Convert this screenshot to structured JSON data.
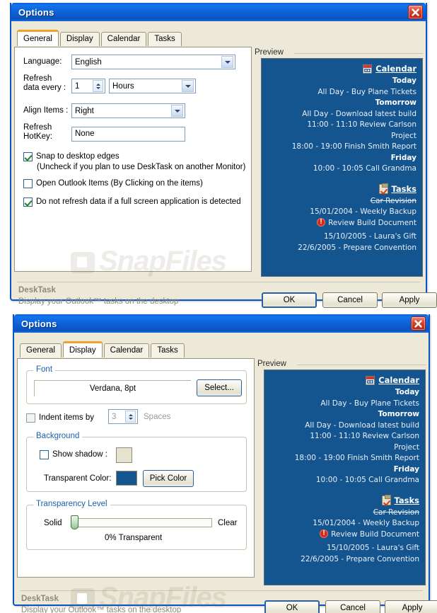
{
  "app": {
    "name": "DeskTask",
    "description": "Display your Outlook™ tasks on the desktop",
    "watermark": "SnapFiles"
  },
  "colors": {
    "titlebar_blue": "#0c60d6",
    "preview_background": "#14548f",
    "transparent_color_swatch": "#14548f",
    "shadow_swatch": "#e5e3cf",
    "active_tab_accent": "#f0a32a",
    "group_title": "#1b5fa8"
  },
  "dialog1": {
    "title": "Options",
    "close_icon": "close-icon",
    "tabs": [
      {
        "label": "General",
        "active": true
      },
      {
        "label": "Display",
        "active": false
      },
      {
        "label": "Calendar",
        "active": false
      },
      {
        "label": "Tasks",
        "active": false
      }
    ],
    "general": {
      "language_label": "Language:",
      "language_value": "English",
      "refresh_label": "Refresh\ndata every :",
      "refresh_number": "1",
      "refresh_unit": "Hours",
      "align_label": "Align Items :",
      "align_value": "Right",
      "hotkey_label": "Refresh\nHotKey:",
      "hotkey_value": "None",
      "checkbox_snap": "Snap to desktop edges",
      "checkbox_snap_note": "(Uncheck if you plan to use DeskTask on another Monitor)",
      "checkbox_open_outlook": "Open Outlook Items (By Clicking on the items)",
      "checkbox_no_refresh": "Do not refresh data if a full screen application is detected"
    },
    "preview_label": "Preview",
    "buttons": {
      "ok": "OK",
      "cancel": "Cancel",
      "apply": "Apply"
    }
  },
  "dialog2": {
    "title": "Options",
    "close_icon": "close-icon",
    "tabs": [
      {
        "label": "General",
        "active": false
      },
      {
        "label": "Display",
        "active": true
      },
      {
        "label": "Calendar",
        "active": false
      },
      {
        "label": "Tasks",
        "active": false
      }
    ],
    "display": {
      "font_group": "Font",
      "font_value": "Verdana, 8pt",
      "font_select_button": "Select...",
      "indent_label": "Indent items by",
      "indent_value": "3",
      "indent_unit": "Spaces",
      "background_group": "Background",
      "show_shadow_label": "Show shadow :",
      "transparent_color_label": "Transparent Color:",
      "pick_color_button": "Pick Color",
      "transparency_group": "Transparency Level",
      "slider_min_label": "Solid",
      "slider_max_label": "Clear",
      "transparency_value": "0% Transparent"
    },
    "preview_label": "Preview",
    "buttons": {
      "ok": "OK",
      "cancel": "Cancel",
      "apply": "Apply"
    }
  },
  "preview": {
    "calendar_header": "Calendar",
    "calendar_icon": "calendar-icon",
    "tasks_header": "Tasks",
    "tasks_icon": "tasks-clipboard-icon",
    "warning_icon": "warning-exclamation-icon",
    "calendar_items": [
      {
        "text": "Today",
        "style": "bold"
      },
      {
        "text": "All Day - Buy Plane Tickets",
        "style": "normal"
      },
      {
        "text": "Tomorrow",
        "style": "bold"
      },
      {
        "text": "All Day - Download latest build",
        "style": "normal"
      },
      {
        "text": "11:00 - 11:10 Review Carlson",
        "style": "normal"
      },
      {
        "text": "Project",
        "style": "normal"
      },
      {
        "text": "18:00 - 19:00 Finish Smith Report",
        "style": "normal"
      },
      {
        "text": "Friday",
        "style": "bold"
      },
      {
        "text": "10:00 - 10:05 Call Grandma",
        "style": "normal"
      }
    ],
    "task_items": [
      {
        "text": "Car Revision",
        "style": "strike",
        "icon": ""
      },
      {
        "text": "15/01/2004 - Weekly Backup",
        "style": "normal",
        "icon": ""
      },
      {
        "text": "Review Build Document",
        "style": "normal",
        "icon": "warning"
      },
      {
        "text": "15/10/2005 - Laura's Gift",
        "style": "normal",
        "icon": ""
      },
      {
        "text": "22/6/2005 - Prepare Convention",
        "style": "normal",
        "icon": ""
      }
    ]
  }
}
